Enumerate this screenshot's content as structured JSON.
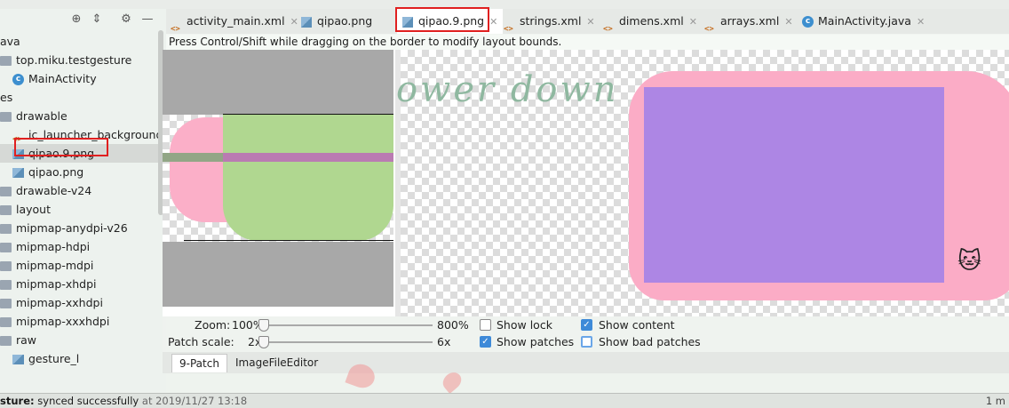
{
  "sidebar": {
    "items": [
      {
        "label": "ava",
        "kind": "text"
      },
      {
        "label": "top.miku.testgesture",
        "kind": "folder"
      },
      {
        "label": "MainActivity",
        "kind": "class"
      },
      {
        "label": "es",
        "kind": "text"
      },
      {
        "label": "drawable",
        "kind": "folder"
      },
      {
        "label": "ic_launcher_background.xml",
        "kind": "xml"
      },
      {
        "label": "qipao.9.png",
        "kind": "image"
      },
      {
        "label": "qipao.png",
        "kind": "image"
      },
      {
        "label": "drawable-v24",
        "kind": "folder"
      },
      {
        "label": "layout",
        "kind": "folder"
      },
      {
        "label": "mipmap-anydpi-v26",
        "kind": "folder"
      },
      {
        "label": "mipmap-hdpi",
        "kind": "folder"
      },
      {
        "label": "mipmap-mdpi",
        "kind": "folder"
      },
      {
        "label": "mipmap-xhdpi",
        "kind": "folder"
      },
      {
        "label": "mipmap-xxhdpi",
        "kind": "folder"
      },
      {
        "label": "mipmap-xxxhdpi",
        "kind": "folder"
      },
      {
        "label": "raw",
        "kind": "folder"
      },
      {
        "label": "gesture_l",
        "kind": "image"
      }
    ],
    "selected": "qipao.9.png"
  },
  "tabs": [
    {
      "label": "activity_main.xml",
      "icon": "xml-file-icon"
    },
    {
      "label": "qipao.png",
      "icon": "image-file-icon"
    },
    {
      "label": "qipao.9.png",
      "icon": "image-file-icon",
      "active": true
    },
    {
      "label": "strings.xml",
      "icon": "xml-file-icon"
    },
    {
      "label": "dimens.xml",
      "icon": "xml-file-icon"
    },
    {
      "label": "arrays.xml",
      "icon": "xml-file-icon"
    },
    {
      "label": "MainActivity.java",
      "icon": "class-icon"
    }
  ],
  "editor": {
    "hint": "Press Control/Shift while dragging on the border to modify layout bounds.",
    "preview_text": "ower down"
  },
  "controls": {
    "zoom_label": "Zoom:",
    "zoom_min": "100%",
    "zoom_max": "800%",
    "zoom_value": 0,
    "patch_scale_label": "Patch scale:",
    "patch_min": "2x",
    "patch_max": "6x",
    "patch_value": 0,
    "show_lock": {
      "label": "Show lock",
      "checked": false
    },
    "show_patches": {
      "label": "Show patches",
      "checked": true
    },
    "show_content": {
      "label": "Show content",
      "checked": true
    },
    "show_bad_patches": {
      "label": "Show bad patches",
      "checked": false
    }
  },
  "bottom_tabs": [
    "9-Patch",
    "ImageFileEditor"
  ],
  "status": {
    "prefix": "sture:",
    "message": "synced successfully",
    "time": "at 2019/11/27 13:18",
    "right": "1 m"
  },
  "colors": {
    "highlight_red": "#e02020",
    "checkbox_blue": "#3e8ad8",
    "pink": "#fbacc6",
    "purple": "#ad86e4",
    "green": "#b0d790"
  }
}
